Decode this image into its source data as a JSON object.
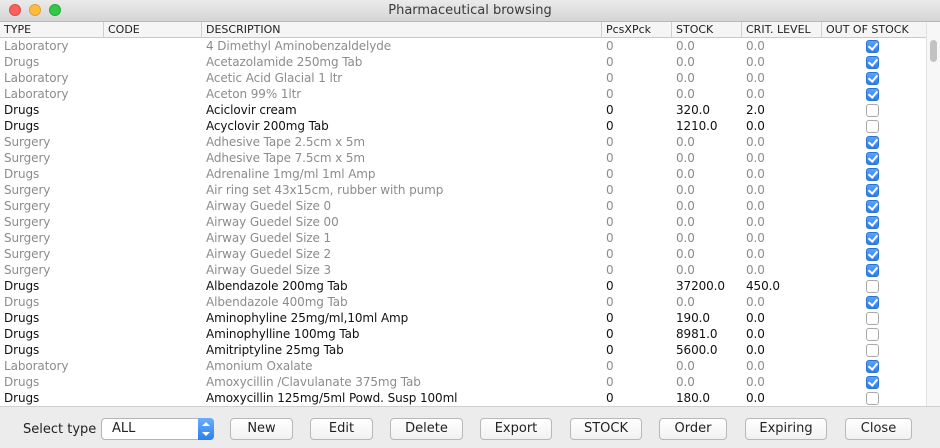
{
  "window": {
    "title": "Pharmaceutical browsing"
  },
  "table": {
    "columns": [
      "TYPE",
      "CODE",
      "DESCRIPTION",
      "PcsXPck",
      "STOCK",
      "CRIT. LEVEL",
      "OUT OF STOCK"
    ],
    "rows": [
      {
        "type": "Laboratory",
        "code": "",
        "description": "4 Dimethyl Aminobenzaldelyde",
        "pcs": "0",
        "stock": "0.0",
        "crit": "0.0",
        "out_of_stock": true
      },
      {
        "type": "Drugs",
        "code": "",
        "description": "Acetazolamide 250mg Tab",
        "pcs": "0",
        "stock": "0.0",
        "crit": "0.0",
        "out_of_stock": true
      },
      {
        "type": "Laboratory",
        "code": "",
        "description": "Acetic Acid Glacial 1 ltr",
        "pcs": "0",
        "stock": "0.0",
        "crit": "0.0",
        "out_of_stock": true
      },
      {
        "type": "Laboratory",
        "code": "",
        "description": "Aceton 99% 1ltr",
        "pcs": "0",
        "stock": "0.0",
        "crit": "0.0",
        "out_of_stock": true
      },
      {
        "type": "Drugs",
        "code": "",
        "description": "Aciclovir cream",
        "pcs": "0",
        "stock": "320.0",
        "crit": "2.0",
        "out_of_stock": false
      },
      {
        "type": "Drugs",
        "code": "",
        "description": "Acyclovir 200mg Tab",
        "pcs": "0",
        "stock": "1210.0",
        "crit": "0.0",
        "out_of_stock": false
      },
      {
        "type": "Surgery",
        "code": "",
        "description": "Adhesive Tape 2.5cm x 5m",
        "pcs": "0",
        "stock": "0.0",
        "crit": "0.0",
        "out_of_stock": true
      },
      {
        "type": "Surgery",
        "code": "",
        "description": "Adhesive Tape 7.5cm x 5m",
        "pcs": "0",
        "stock": "0.0",
        "crit": "0.0",
        "out_of_stock": true
      },
      {
        "type": "Drugs",
        "code": "",
        "description": "Adrenaline 1mg/ml 1ml Amp",
        "pcs": "0",
        "stock": "0.0",
        "crit": "0.0",
        "out_of_stock": true
      },
      {
        "type": "Surgery",
        "code": "",
        "description": "Air ring set 43x15cm, rubber with pump",
        "pcs": "0",
        "stock": "0.0",
        "crit": "0.0",
        "out_of_stock": true
      },
      {
        "type": "Surgery",
        "code": "",
        "description": "Airway Guedel Size 0",
        "pcs": "0",
        "stock": "0.0",
        "crit": "0.0",
        "out_of_stock": true
      },
      {
        "type": "Surgery",
        "code": "",
        "description": "Airway Guedel Size 00",
        "pcs": "0",
        "stock": "0.0",
        "crit": "0.0",
        "out_of_stock": true
      },
      {
        "type": "Surgery",
        "code": "",
        "description": "Airway Guedel Size 1",
        "pcs": "0",
        "stock": "0.0",
        "crit": "0.0",
        "out_of_stock": true
      },
      {
        "type": "Surgery",
        "code": "",
        "description": "Airway Guedel Size 2",
        "pcs": "0",
        "stock": "0.0",
        "crit": "0.0",
        "out_of_stock": true
      },
      {
        "type": "Surgery",
        "code": "",
        "description": "Airway Guedel Size 3",
        "pcs": "0",
        "stock": "0.0",
        "crit": "0.0",
        "out_of_stock": true
      },
      {
        "type": "Drugs",
        "code": "",
        "description": "Albendazole 200mg Tab",
        "pcs": "0",
        "stock": "37200.0",
        "crit": "450.0",
        "out_of_stock": false
      },
      {
        "type": "Drugs",
        "code": "",
        "description": "Albendazole 400mg Tab",
        "pcs": "0",
        "stock": "0.0",
        "crit": "0.0",
        "out_of_stock": true
      },
      {
        "type": "Drugs",
        "code": "",
        "description": "Aminophyline 25mg/ml,10ml Amp",
        "pcs": "0",
        "stock": "190.0",
        "crit": "0.0",
        "out_of_stock": false
      },
      {
        "type": "Drugs",
        "code": "",
        "description": "Aminophylline 100mg Tab",
        "pcs": "0",
        "stock": "8981.0",
        "crit": "0.0",
        "out_of_stock": false
      },
      {
        "type": "Drugs",
        "code": "",
        "description": "Amitriptyline 25mg Tab",
        "pcs": "0",
        "stock": "5600.0",
        "crit": "0.0",
        "out_of_stock": false
      },
      {
        "type": "Laboratory",
        "code": "",
        "description": "Amonium Oxalate",
        "pcs": "0",
        "stock": "0.0",
        "crit": "0.0",
        "out_of_stock": true
      },
      {
        "type": "Drugs",
        "code": "",
        "description": "Amoxycillin /Clavulanate 375mg Tab",
        "pcs": "0",
        "stock": "0.0",
        "crit": "0.0",
        "out_of_stock": true
      },
      {
        "type": "Drugs",
        "code": "",
        "description": "Amoxycillin 125mg/5ml Powd. Susp 100ml",
        "pcs": "0",
        "stock": "180.0",
        "crit": "0.0",
        "out_of_stock": false
      }
    ]
  },
  "toolbar": {
    "select_label": "Select type",
    "select_value": "ALL",
    "buttons": [
      "New",
      "Edit",
      "Delete",
      "Export",
      "STOCK",
      "Order",
      "Expiring",
      "Close"
    ]
  },
  "colors": {
    "active_text": "#111111",
    "dim_text": "#8c8c8c",
    "checkbox_on": "#2b7ff0"
  }
}
